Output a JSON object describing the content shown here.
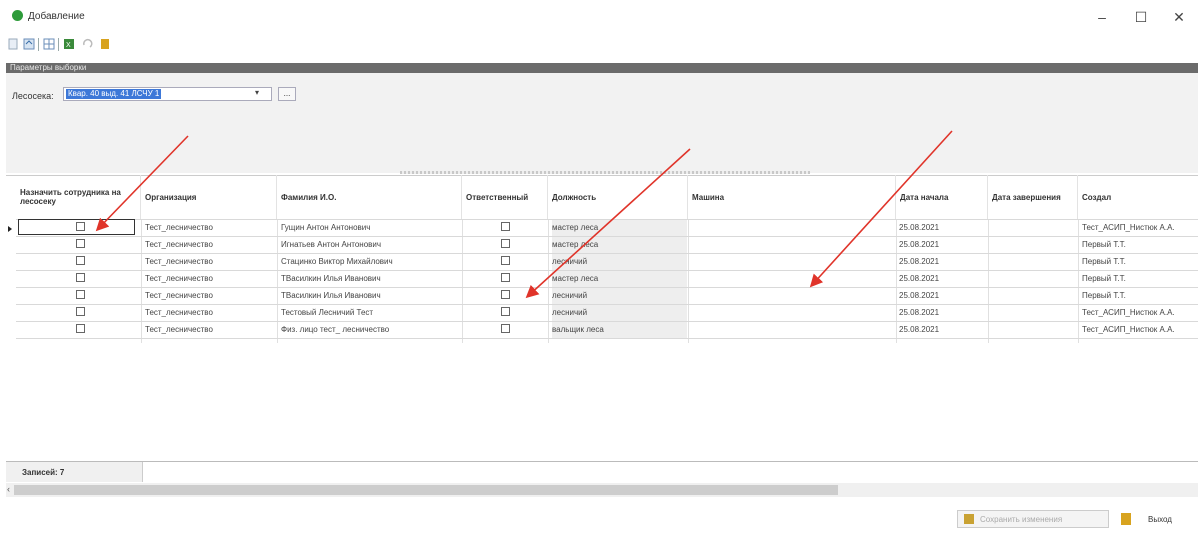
{
  "window": {
    "title": "Добавление",
    "minimize": "–",
    "maximize": "☐",
    "close": "✕"
  },
  "toolbar": {
    "icons": [
      "doc-icon",
      "refresh-icon",
      "grid-icon",
      "export-icon",
      "undo-icon",
      "exit-icon"
    ]
  },
  "params": {
    "title": "Параметры выборки",
    "lesoseka_label": "Лесосека:",
    "lesoseka_value": "Квар. 40 выд. 41 ЛСЧУ 1",
    "dropdown_arrow": "▾",
    "ellipsis": "..."
  },
  "grid": {
    "columns": [
      "Назначить сотрудника на лесосеку",
      "Организация",
      "Фамилия И.О.",
      "Ответственный",
      "Должность",
      "Машина",
      "Дата начала",
      "Дата завершения",
      "Создал"
    ],
    "rows": [
      {
        "org": "Тест_лесничество",
        "fio": "Гущин Антон Антонович",
        "dolzh": "мастер леса",
        "date": "25.08.2021",
        "created": "Тест_АСИП_Нистюк А.А."
      },
      {
        "org": "Тест_лесничество",
        "fio": "Игнатьев Антон Антонович",
        "dolzh": "мастер леса",
        "date": "25.08.2021",
        "created": "Первый Т.Т."
      },
      {
        "org": "Тест_лесничество",
        "fio": "Стацинко Виктор Михайлович",
        "dolzh": "лесничий",
        "date": "25.08.2021",
        "created": "Первый Т.Т."
      },
      {
        "org": "Тест_лесничество",
        "fio": "ТВасилкин Илья Иванович",
        "dolzh": "мастер леса",
        "date": "25.08.2021",
        "created": "Первый Т.Т."
      },
      {
        "org": "Тест_лесничество",
        "fio": "ТВасилкин Илья Иванович",
        "dolzh": "лесничий",
        "date": "25.08.2021",
        "created": "Первый Т.Т."
      },
      {
        "org": "Тест_лесничество",
        "fio": "Тестовый Лесничий Тест",
        "dolzh": "лесничий",
        "date": "25.08.2021",
        "created": "Тест_АСИП_Нистюк А.А."
      },
      {
        "org": "Тест_лесничество",
        "fio": "Физ. лицо тест_ лесничество",
        "dolzh": "вальщик леса",
        "date": "25.08.2021",
        "created": "Тест_АСИП_Нистюк А.А."
      }
    ]
  },
  "footer": {
    "records_label": "Записей: 7",
    "scroll_left": "‹"
  },
  "buttons": {
    "save_label": "Сохранить изменения",
    "exit_label": "Выход"
  },
  "colors": {
    "accent_selection": "#3d78d8",
    "annotation_arrow": "#e0342a"
  }
}
